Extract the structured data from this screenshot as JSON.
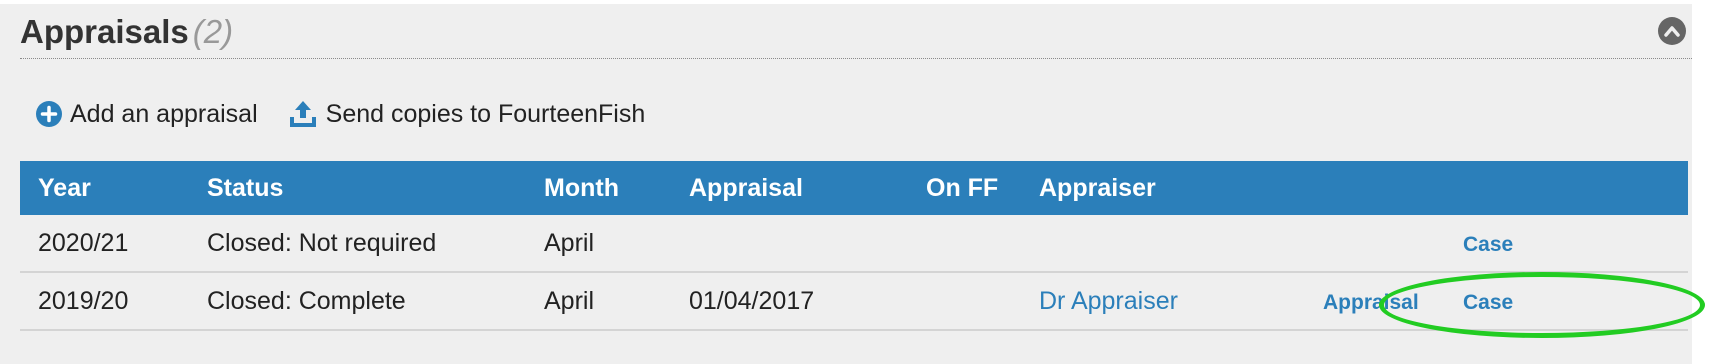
{
  "panel": {
    "title": "Appraisals",
    "count": "(2)",
    "collapse_icon": "chevron-up-circle-icon"
  },
  "actions": {
    "add": {
      "label": "Add an appraisal",
      "icon": "plus-circle-icon"
    },
    "send": {
      "label": "Send copies to FourteenFish",
      "icon": "upload-icon"
    }
  },
  "table": {
    "headers": [
      "Year",
      "Status",
      "Month",
      "Appraisal",
      "On FF",
      "Appraiser",
      ""
    ],
    "rows": [
      {
        "year": "2020/21",
        "status": "Closed: Not required",
        "month": "April",
        "appraisal": "",
        "on_ff": "",
        "appraiser": "",
        "appraisal_link": "",
        "case_link": "Case"
      },
      {
        "year": "2019/20",
        "status": "Closed: Complete",
        "month": "April",
        "appraisal": "01/04/2017",
        "on_ff": "",
        "appraiser": "Dr Appraiser",
        "appraisal_link": "Appraisal",
        "case_link": "Case"
      }
    ]
  },
  "colors": {
    "header_bg": "#2b7fba",
    "link": "#2b7fba",
    "highlight": "#22cc22",
    "panel_bg": "#efefef"
  }
}
